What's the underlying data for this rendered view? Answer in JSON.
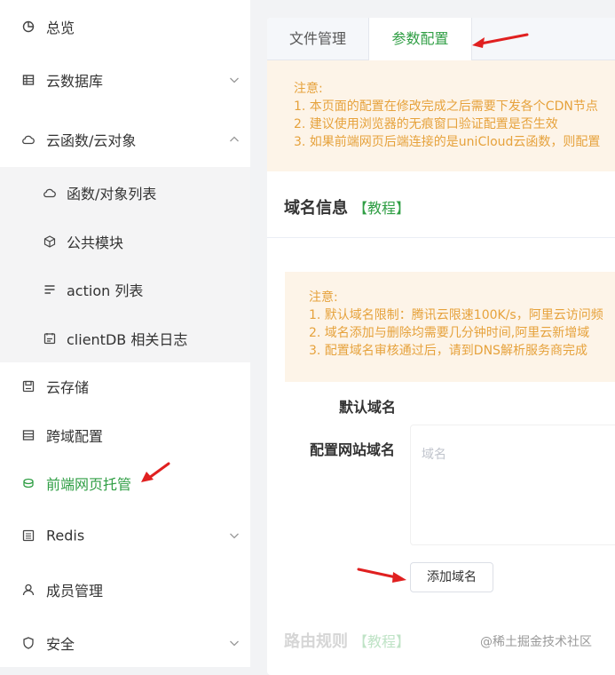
{
  "sidebar": {
    "items": [
      {
        "label": "总览"
      },
      {
        "label": "云数据库"
      },
      {
        "label": "云函数/云对象"
      },
      {
        "label": "云存储"
      },
      {
        "label": "跨域配置"
      },
      {
        "label": "前端网页托管"
      },
      {
        "label": "Redis"
      },
      {
        "label": "成员管理"
      },
      {
        "label": "安全"
      }
    ],
    "sub_items": [
      {
        "label": "函数/对象列表"
      },
      {
        "label": "公共模块"
      },
      {
        "label": "action 列表"
      },
      {
        "label": "clientDB 相关日志"
      }
    ],
    "active_color": "#2f9e44"
  },
  "tabs": [
    {
      "label": "文件管理"
    },
    {
      "label": "参数配置"
    }
  ],
  "notice1": {
    "title": "注意:",
    "lines": [
      "1. 本页面的配置在修改完成之后需要下发各个CDN节点",
      "2. 建议使用浏览器的无痕窗口验证配置是否生效",
      "3. 如果前端网页后端连接的是uniCloud云函数，则配置"
    ]
  },
  "domain_section": {
    "title": "域名信息",
    "tutorial_link": "【教程】"
  },
  "notice2": {
    "title": "注意:",
    "lines": [
      "1. 默认域名限制：腾讯云限速100K/s，阿里云访问频",
      "2. 域名添加与删除均需要几分钟时间,阿里云新增域",
      "3. 配置域名审核通过后，请到DNS解析服务商完成"
    ]
  },
  "form": {
    "default_domain_label": "默认域名",
    "custom_domain_label": "配置网站域名",
    "domain_placeholder": "域名",
    "add_button": "添加域名"
  },
  "route_section": {
    "title": "路由规则",
    "tutorial_link": "【教程】"
  },
  "watermark": "@稀土掘金技术社区",
  "colors": {
    "accent": "#2f9e44",
    "notice_bg": "#fdf4e8",
    "notice_text": "#e6a23c",
    "arrow": "#e02020"
  }
}
